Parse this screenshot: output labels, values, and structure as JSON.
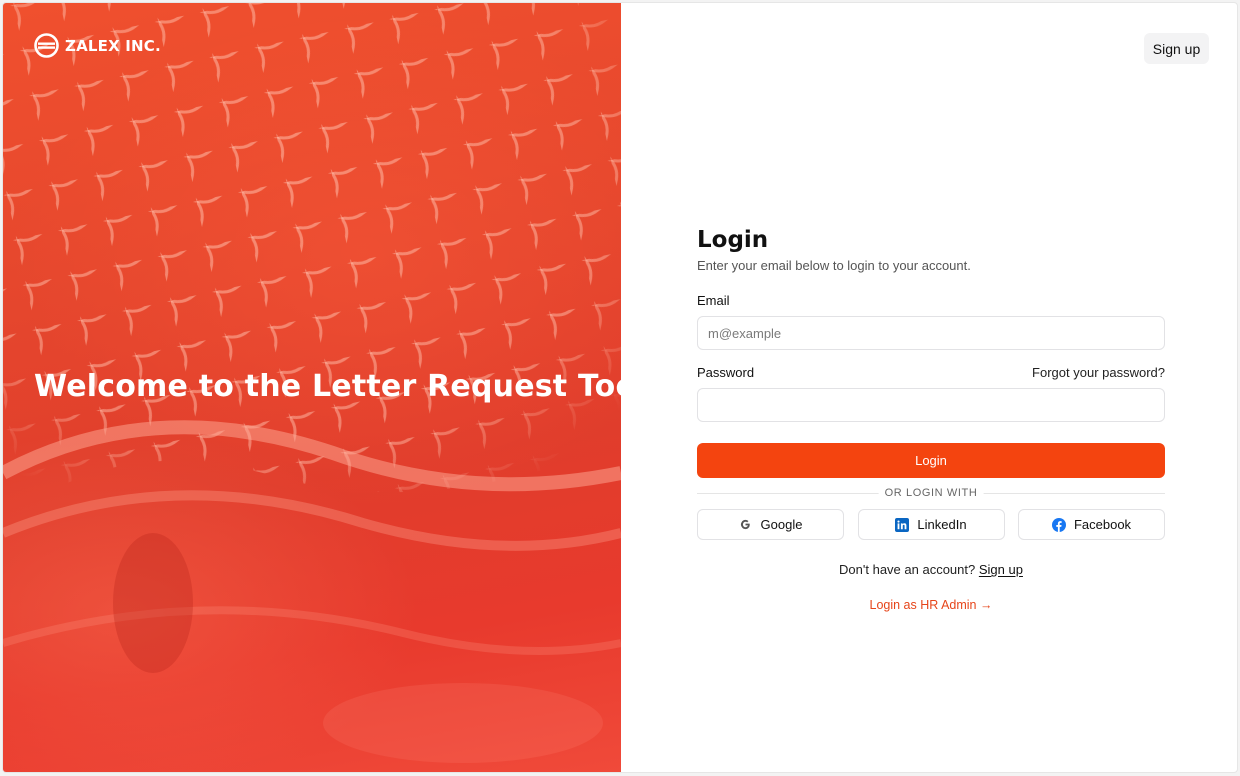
{
  "brand": {
    "name": "ZALEX INC.",
    "logo_icon": "zalex-logo-icon"
  },
  "hero": {
    "title": "Welcome to the Letter Request Tool"
  },
  "header": {
    "signup_label": "Sign up"
  },
  "form": {
    "title": "Login",
    "subtitle": "Enter your email below to login to your account.",
    "email_label": "Email",
    "email_placeholder": "m@example",
    "email_value": "",
    "password_label": "Password",
    "forgot_label": "Forgot your password?",
    "password_value": "",
    "login_label": "Login",
    "divider_label": "OR LOGIN WITH",
    "social": [
      {
        "label": "Google",
        "icon": "google-icon"
      },
      {
        "label": "LinkedIn",
        "icon": "linkedin-icon"
      },
      {
        "label": "Facebook",
        "icon": "facebook-icon"
      }
    ],
    "no_account_text": "Don't have an account?",
    "signup_link_label": "Sign up",
    "hr_admin_label": "Login as HR Admin →"
  },
  "colors": {
    "accent": "#f4440f",
    "hero_bg": "#e5462d",
    "link_accent": "#e6451a",
    "linkedin": "#0a66c2",
    "facebook": "#1877f2"
  }
}
